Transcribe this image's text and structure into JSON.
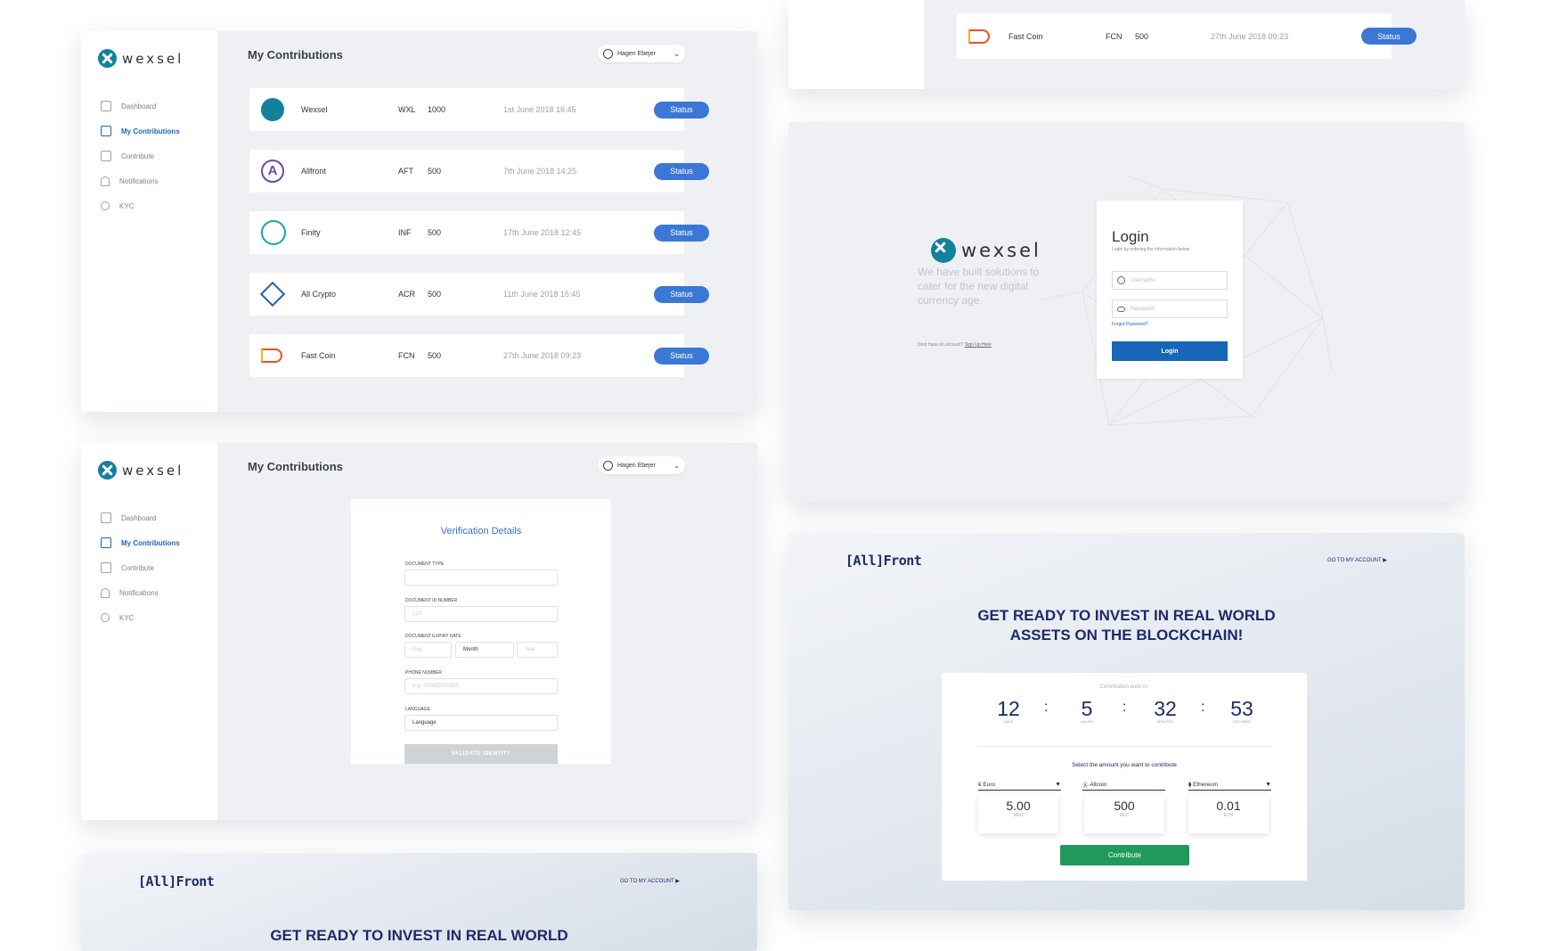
{
  "brand": {
    "name": "wexsel"
  },
  "nav": {
    "dashboard": "Dashboard",
    "contributions": "My Contributions",
    "contribute": "Contribute",
    "notifications": "Notifications",
    "kyc": "KYC"
  },
  "page_title": "My Contributions",
  "user": {
    "name": "Hagen Ebejer"
  },
  "contributions": [
    {
      "name": "Wexsel",
      "symbol": "WXL",
      "amount": "1000",
      "date": "1st June 2018 16:45",
      "action": "Status",
      "icon_color": "#12819c"
    },
    {
      "name": "Allfront",
      "symbol": "AFT",
      "amount": "500",
      "date": "7th June 2018 14:25",
      "action": "Status",
      "icon_color": "#6a4aa5"
    },
    {
      "name": "Finity",
      "symbol": "INF",
      "amount": "500",
      "date": "17th June 2018 12:45",
      "action": "Status",
      "icon_color": "#15a8a0"
    },
    {
      "name": "All Crypto",
      "symbol": "ACR",
      "amount": "500",
      "date": "11th June 2018 16:45",
      "action": "Status",
      "icon_color": "#2c5aa8"
    },
    {
      "name": "Fast Coin",
      "symbol": "FCN",
      "amount": "500",
      "date": "27th June 2018 09:23",
      "action": "Status",
      "icon_color": "#e8521f"
    }
  ],
  "verification": {
    "title": "Verification Details",
    "doc_type_label": "DOCUMENT TYPE",
    "doc_id_label": "DOCUMENT ID NUMBER",
    "doc_id_placeholder": "123",
    "expiry_label": "DOCUMENT EXPIRY DATE",
    "day_placeholder": "Day",
    "month_value": "Month",
    "year_placeholder": "Year",
    "phone_label": "PHONE NUMBER",
    "phone_placeholder": "e.g. +35655555555",
    "language_label": "LANGUAGE",
    "language_value": "Language",
    "validate_button": "VALIDATE IDENTITY"
  },
  "allfront": {
    "logo": "[All]Front",
    "goto": "GO TO MY ACCOUNT ▶",
    "headline_1": "GET READY TO INVEST IN REAL WORLD",
    "headline_2": "ASSETS ON THE BLOCKCHAIN!",
    "countdown_caption": "Contribution ends in:",
    "countdown": {
      "days": "12",
      "hours": "5",
      "minutes": "32",
      "seconds": "53"
    },
    "countdown_labels": {
      "days": "DAYS",
      "hours": "HOURS",
      "minutes": "MINUTES",
      "seconds": "SECONDS"
    },
    "select_prompt": "Select the amount you want to contribute",
    "currencies": [
      {
        "symbol": "€",
        "name": "Euro",
        "value": "5.00",
        "unit": "ERU"
      },
      {
        "symbol": "Ⓐ",
        "name": "Allcoin",
        "value": "500",
        "unit": "AFC"
      },
      {
        "symbol": "⧫",
        "name": "Ethereum",
        "value": "0.01",
        "unit": "ETH"
      }
    ],
    "contribute_button": "Contribute"
  },
  "login": {
    "title": "Login",
    "subtitle": "Login by entering the information below",
    "username_placeholder": "Username",
    "password_placeholder": "Password",
    "forgot": "Forgot Password?",
    "button": "Login",
    "tagline": "We have built solutions to cater for the new digital currency age.",
    "no_account": "Dont have an  account?",
    "signup_link": "Sign Up Here"
  },
  "colors": {
    "primary_blue": "#3b78d6",
    "navy": "#1d2a6b",
    "green": "#1f9a5b",
    "teal": "#12819c"
  }
}
